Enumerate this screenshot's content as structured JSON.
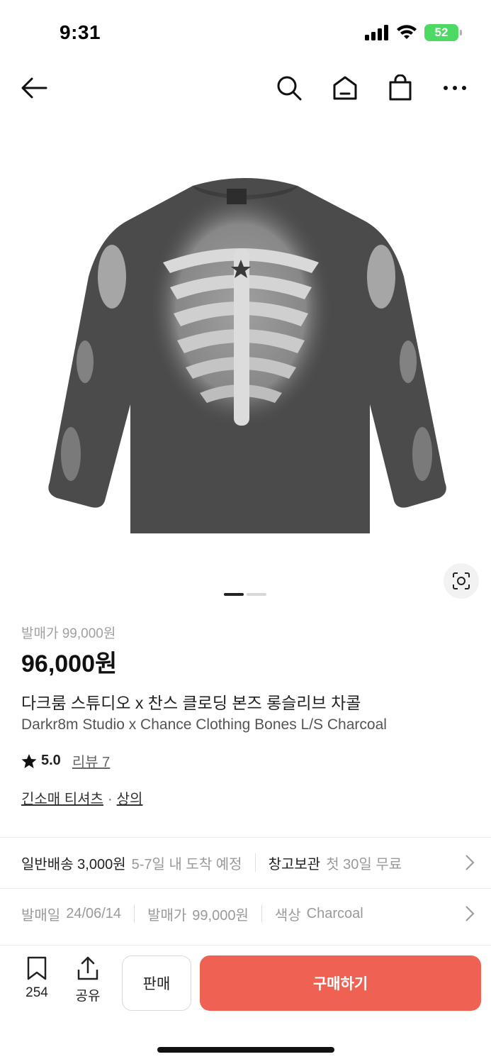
{
  "status": {
    "time": "9:31",
    "battery": "52"
  },
  "product": {
    "release_price_label": "발매가 99,000원",
    "price": "96,000원",
    "title_ko": "다크룸 스튜디오 x 찬스 클로딩 본즈 롱슬리브 차콜",
    "title_en": "Darkr8m Studio x Chance Clothing Bones L/S Charcoal",
    "rating": "5.0",
    "review_label": "리뷰 7",
    "category_primary": "긴소매 티셔츠",
    "category_separator": "·",
    "category_secondary": "상의",
    "image_count": 2,
    "image_index": 1
  },
  "shipping": {
    "delivery_label": "일반배송 3,000원",
    "delivery_eta": "5-7일 내 도착 예정",
    "storage_label": "창고보관",
    "storage_note": "첫 30일 무료"
  },
  "details": {
    "release_date_key": "발매일",
    "release_date_value": "24/06/14",
    "release_price_key": "발매가",
    "release_price_value": "99,000원",
    "color_key": "색상",
    "color_value": "Charcoal"
  },
  "bottom_bar": {
    "bookmark_count": "254",
    "share_label": "공유",
    "sell_label": "판매",
    "buy_label": "구매하기"
  },
  "colors": {
    "buy": "#ef6253",
    "battery": "#4cd964"
  },
  "icons": [
    "back-arrow-icon",
    "search-icon",
    "home-icon",
    "shopping-bag-icon",
    "more-icon",
    "lens-search-icon",
    "star-icon",
    "bookmark-icon",
    "share-icon",
    "chevron-right-icon"
  ]
}
